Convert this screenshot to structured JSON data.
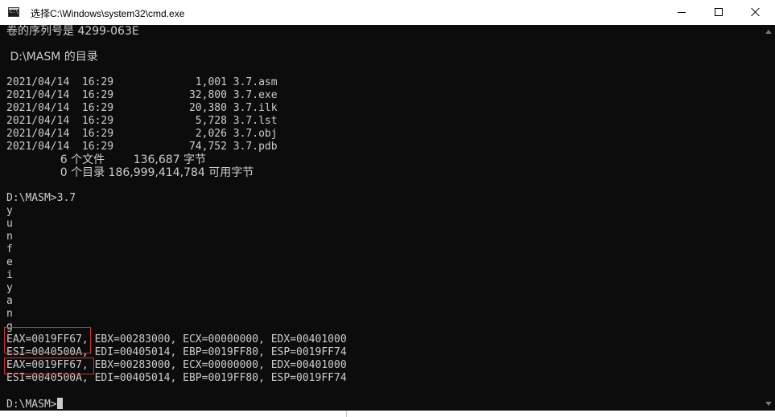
{
  "window": {
    "title": "选择C:\\Windows\\system32\\cmd.exe",
    "icon": "cmd-icon",
    "icon_text": "C:\\",
    "controls": {
      "minimize_icon": "minimize-icon",
      "maximize_icon": "maximize-icon",
      "close_icon": "close-icon"
    }
  },
  "colors": {
    "console_background": "#0c0c0c",
    "console_text": "#cccccc",
    "highlight_box": "#d32f2f"
  },
  "console": {
    "volume_serial": "卷的序列号是 4299-063E",
    "dir_header": " D:\\MASM 的目录",
    "file_listing": [
      "2021/04/14  16:29             1,001 3.7.asm",
      "2021/04/14  16:29            32,800 3.7.exe",
      "2021/04/14  16:29            20,380 3.7.ilk",
      "2021/04/14  16:29             5,728 3.7.lst",
      "2021/04/14  16:29             2,026 3.7.obj",
      "2021/04/14  16:29            74,752 3.7.pdb"
    ],
    "file_summary": "               6 个文件        136,687 字节",
    "dir_summary": "               0 个目录 186,999,414,784 可用字节",
    "command_prompt": "D:\\MASM>3.7",
    "program_output": [
      "y",
      "u",
      "n",
      "f",
      "e",
      "i",
      "y",
      "a",
      "n",
      "g"
    ],
    "register_lines": [
      "EAX=0019FF67, EBX=00283000, ECX=00000000, EDX=00401000",
      "ESI=0040500A, EDI=00405014, EBP=0019FF80, ESP=0019FF74",
      "EAX=0019FF67, EBX=00283000, ECX=00000000, EDX=00401000",
      "ESI=0040500A, EDI=00405014, EBP=0019FF80, ESP=0019FF74"
    ],
    "final_prompt": "D:\\MASM>"
  }
}
